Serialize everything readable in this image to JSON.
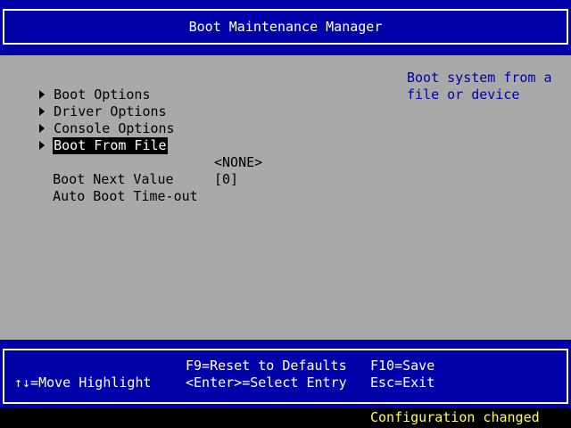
{
  "header": {
    "title": "Boot Maintenance Manager"
  },
  "menu": {
    "items": [
      {
        "label": "Boot Options",
        "selected": false
      },
      {
        "label": "Driver Options",
        "selected": false
      },
      {
        "label": "Console Options",
        "selected": false
      },
      {
        "label": "Boot From File",
        "selected": true
      }
    ]
  },
  "fields": {
    "boot_next_label": "Boot Next Value",
    "boot_next_value": "<NONE>",
    "auto_boot_label": "Auto Boot Time-out",
    "auto_boot_value": "[0]"
  },
  "help": {
    "line1": "Boot system from a",
    "line2": "file or device"
  },
  "footer": {
    "move_highlight": "↑↓=Move Highlight",
    "reset_defaults": "F9=Reset to Defaults",
    "select_entry": "<Enter>=Select Entry",
    "save": "F10=Save",
    "exit": "Esc=Exit"
  },
  "status": {
    "message": "Configuration changed"
  },
  "colors": {
    "background": "#a9a9a9",
    "header_blue": "#0000a8",
    "help_text": "#0000a8",
    "status_yellow": "#ffff54"
  }
}
